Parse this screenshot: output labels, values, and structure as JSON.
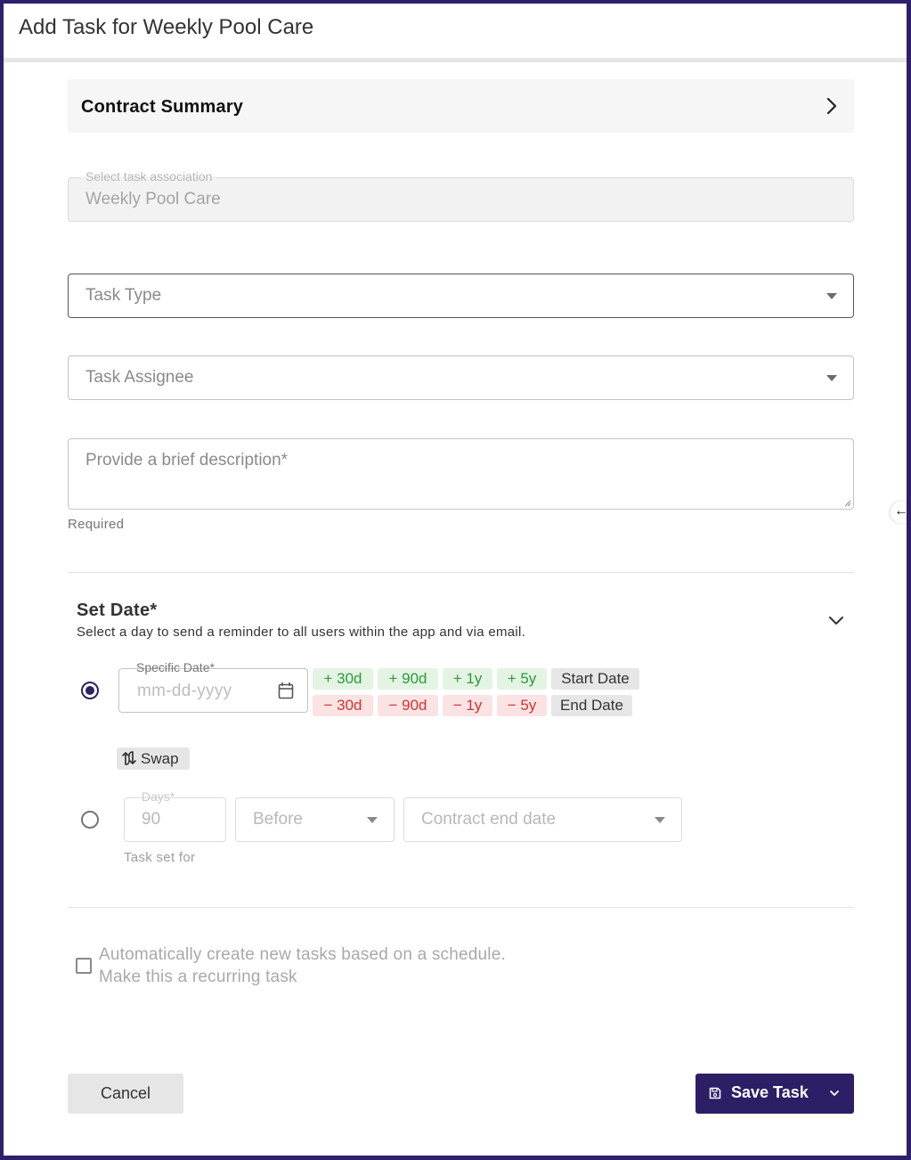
{
  "dialog": {
    "title": "Add Task for Weekly Pool Care"
  },
  "contract_summary": {
    "label": "Contract Summary",
    "icon": "chevron-right-icon"
  },
  "association": {
    "label": "Select task association",
    "value": "Weekly Pool Care"
  },
  "task_type": {
    "placeholder": "Task Type"
  },
  "task_assignee": {
    "placeholder": "Task Assignee"
  },
  "description": {
    "placeholder": "Provide a brief description*",
    "helper": "Required"
  },
  "set_date": {
    "title": "Set Date*",
    "subtitle": "Select a day to send a reminder to all users within the app and via email.",
    "specific_date": {
      "label": "Specific Date*",
      "placeholder": "mm-dd-yyyy",
      "selected": true
    },
    "plus_chips": [
      "+ 30d",
      "+ 90d",
      "+ 1y",
      "+ 5y"
    ],
    "minus_chips": [
      "− 30d",
      "− 90d",
      "− 1y",
      "− 5y"
    ],
    "start_date_label": "Start Date",
    "end_date_label": "End Date",
    "swap_label": "Swap",
    "relative": {
      "days_label": "Days*",
      "days_value": "90",
      "direction": "Before",
      "reference": "Contract end date",
      "helper": "Task set for",
      "selected": false
    }
  },
  "recurring": {
    "line1": "Automatically create new tasks based on a schedule.",
    "line2": "Make this a recurring task",
    "checked": false
  },
  "actions": {
    "cancel_label": "Cancel",
    "save_label": "Save Task"
  },
  "colors": {
    "primary": "#2c1f66",
    "plus_chip_bg": "#e3f4e3",
    "plus_chip_text": "#2e9a3c",
    "minus_chip_bg": "#fbe3e3",
    "minus_chip_text": "#d03434"
  }
}
